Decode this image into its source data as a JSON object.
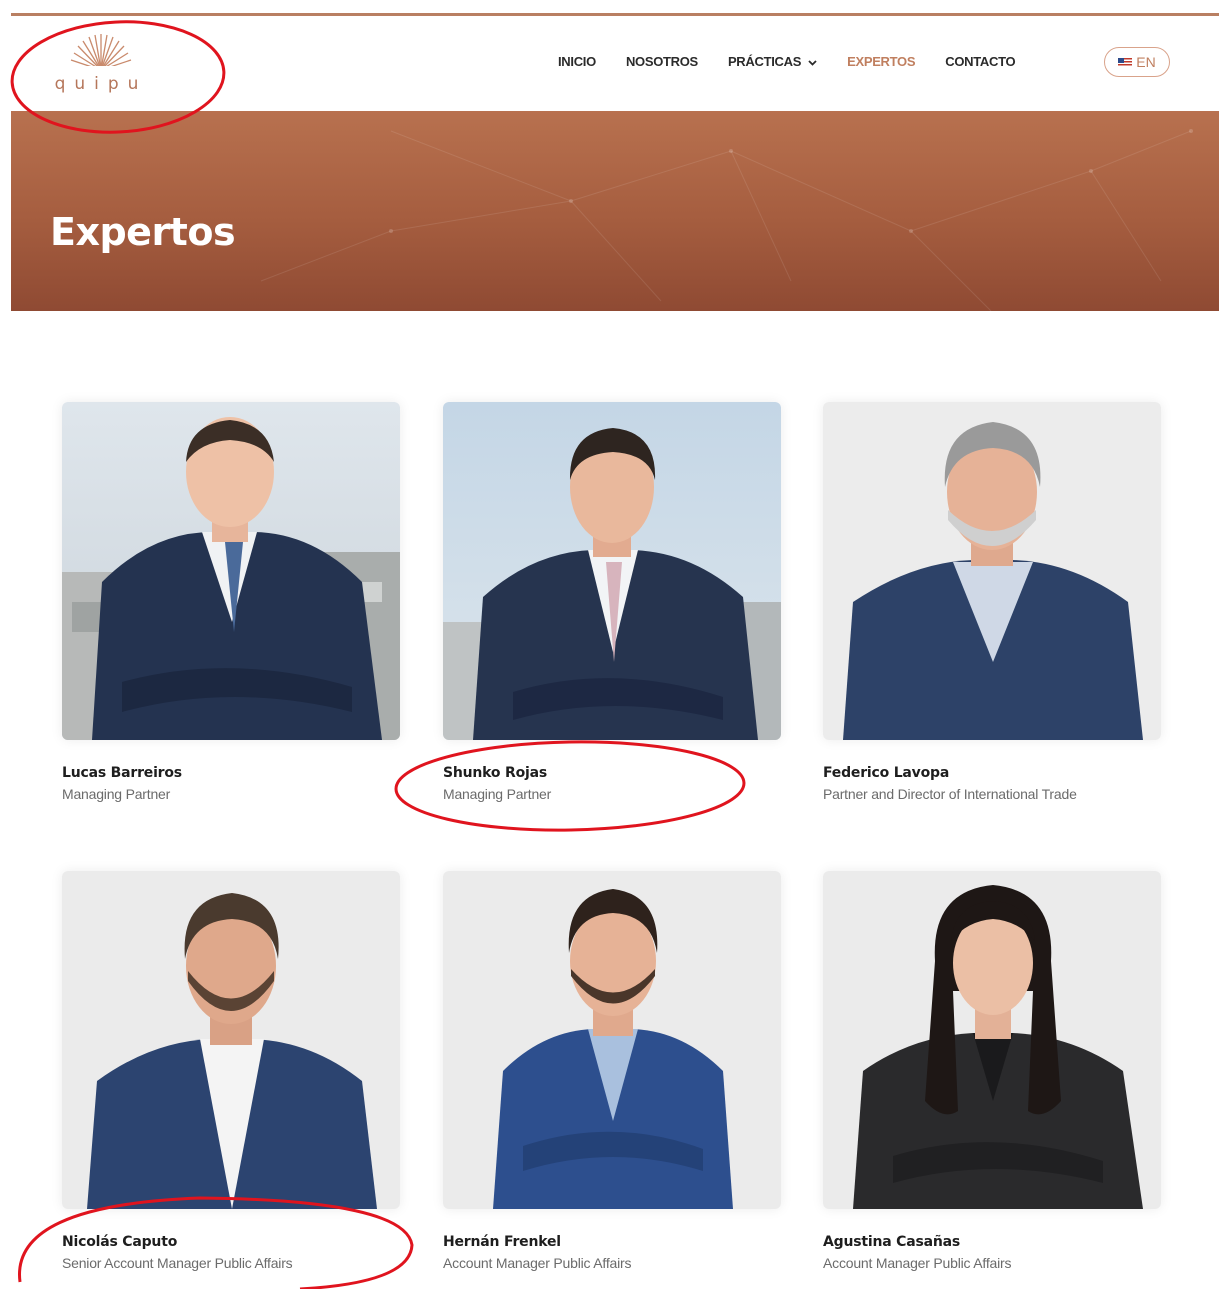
{
  "brand": {
    "logo_text": "quipu",
    "accent": "#c07f5f",
    "hero_color": "#a55d3f"
  },
  "nav": {
    "items": [
      {
        "label": "INICIO",
        "active": false
      },
      {
        "label": "NOSOTROS",
        "active": false
      },
      {
        "label": "PRÁCTICAS",
        "active": false,
        "has_dropdown": true
      },
      {
        "label": "EXPERTOS",
        "active": true
      },
      {
        "label": "CONTACTO",
        "active": false
      }
    ],
    "language": {
      "label": "EN",
      "icon": "us-flag-icon"
    }
  },
  "hero": {
    "title": "Expertos"
  },
  "team": [
    {
      "name": "Lucas Barreiros",
      "role": "Managing Partner"
    },
    {
      "name": "Shunko Rojas",
      "role": "Managing Partner"
    },
    {
      "name": "Federico Lavopa",
      "role": "Partner and Director of International Trade"
    },
    {
      "name": "Nicolás Caputo",
      "role": "Senior Account Manager Public Affairs"
    },
    {
      "name": "Hernán Frenkel",
      "role": "Account Manager Public Affairs"
    },
    {
      "name": "Agustina Casañas",
      "role": "Account Manager Public Affairs"
    }
  ],
  "annotations": {
    "color": "#e0141e"
  }
}
